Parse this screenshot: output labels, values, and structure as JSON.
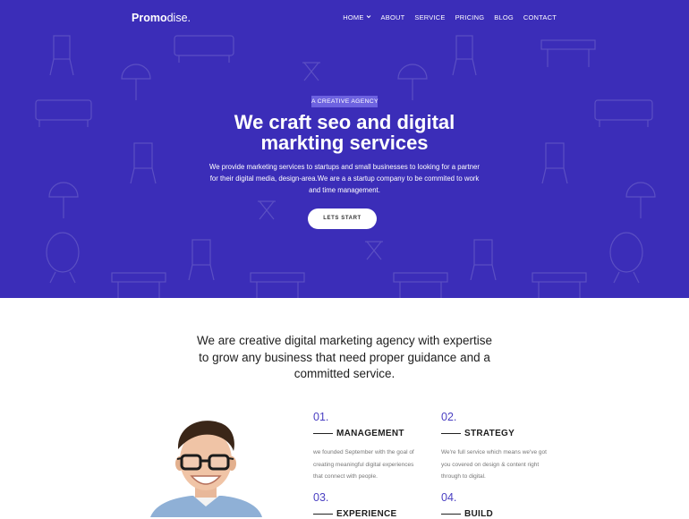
{
  "brand": {
    "bold": "Promo",
    "light": "dise."
  },
  "nav": [
    {
      "label": "HOME",
      "has_dropdown": true
    },
    {
      "label": "ABOUT"
    },
    {
      "label": "SERVICE"
    },
    {
      "label": "PRICING"
    },
    {
      "label": "BLOG"
    },
    {
      "label": "CONTACT"
    }
  ],
  "hero": {
    "badge": "A CREATIVE AGENCY",
    "title_line1": "We craft seo and digital",
    "title_line2": "markting services",
    "desc_line1": "We provide marketing services to startups and small businesses to looking for a partner",
    "desc_line2": "for their digital media, design-area.We are a a startup company to be commited to work",
    "desc_line3": "and time management.",
    "cta": "LETS START",
    "bg_color": "#3b2db8"
  },
  "intro": {
    "line1": "We are creative digital marketing agency with expertise",
    "line2": "to grow any business that need proper guidance and a",
    "line3": "committed service."
  },
  "features": [
    {
      "num": "01.",
      "title": "MANAGEMENT",
      "desc": [
        "we founded September with the goal of",
        "creating meaningful digital experiences",
        "that connect with people."
      ]
    },
    {
      "num": "02.",
      "title": "STRATEGY",
      "desc": [
        "We're full service which means we've got",
        "you covered on design & content right",
        "through to digital."
      ]
    },
    {
      "num": "03.",
      "title": "EXPERIENCE",
      "desc": []
    },
    {
      "num": "04.",
      "title": "BUILD",
      "desc": []
    }
  ],
  "colors": {
    "accent": "#4a3fc2",
    "badge": "#6d62e0"
  }
}
